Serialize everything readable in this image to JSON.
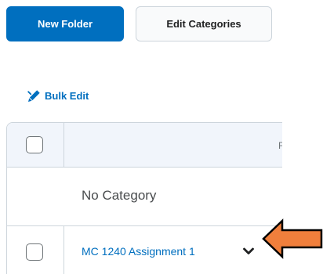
{
  "toolbar": {
    "new_folder_label": "New Folder",
    "edit_categories_label": "Edit Categories"
  },
  "bulk_edit": {
    "label": "Bulk Edit",
    "icon": "pencil-icon"
  },
  "table": {
    "header_fragment": "F",
    "category_label": "No Category",
    "items": [
      {
        "title": "MC 1240 Assignment 1",
        "menu_icon": "chevron-down-icon"
      }
    ]
  },
  "colors": {
    "primary": "#006fbf",
    "header_row_bg": "#f1f5fb",
    "border": "#cdd5dc",
    "annotation_arrow": "#f07f3c"
  }
}
